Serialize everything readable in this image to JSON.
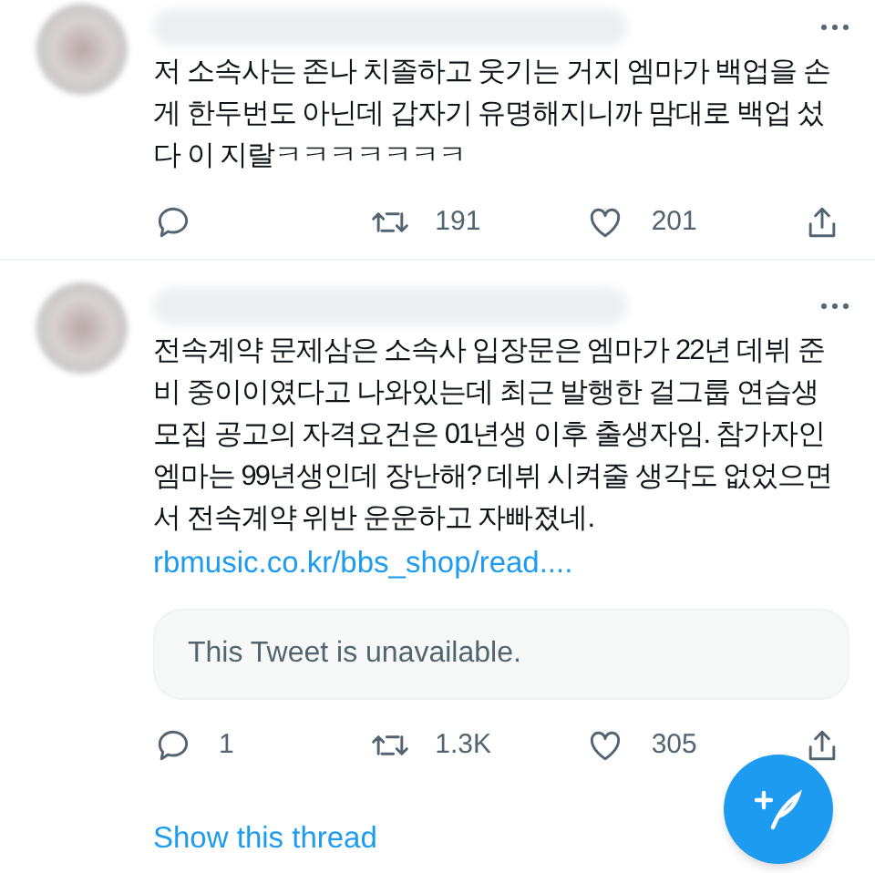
{
  "tweets": [
    {
      "text": "저 소속사는 존나 치졸하고 웃기는 거지 엠마가 백업을 손게 한두번도 아닌데 갑자기 유명해지니까 맘대로 백업 섰다 이 지랄ㅋㅋㅋㅋㅋㅋㅋ",
      "actions": [
        {
          "kind": "reply"
        },
        {
          "kind": "retweet",
          "count": "191"
        },
        {
          "kind": "like",
          "count": "201"
        },
        {
          "kind": "share"
        }
      ]
    },
    {
      "text": "전속계약 문제삼은 소속사 입장문은 엠마가 22년 데뷔 준비 중이이였다고 나와있는데 최근 발행한 걸그룹 연습생 모집 공고의 자격요건은 01년생 이후 출생자임. 참가자인 엠마는 99년생인데 장난해? 데뷔 시켜줄 생각도 없었으면서 전속계약 위반 운운하고 자빠졌네.",
      "link": "rbmusic.co.kr/bbs_shop/read....",
      "quote": "This Tweet is unavailable.",
      "actions": [
        {
          "kind": "reply",
          "count": "1"
        },
        {
          "kind": "retweet",
          "count": "1.3K"
        },
        {
          "kind": "like",
          "count": "305"
        },
        {
          "kind": "share"
        }
      ],
      "thread_link": "Show this thread"
    }
  ]
}
